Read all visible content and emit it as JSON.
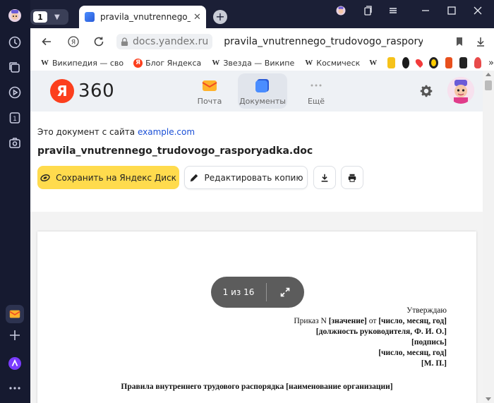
{
  "browser": {
    "tab_count": "1",
    "tab_title": "pravila_vnutrennego_tru",
    "address_domain": "docs.yandex.ru",
    "address_path": "pravila_vnutrennego_trudovogo_raspory"
  },
  "bookmarks": [
    {
      "icon": "W",
      "label": "Википедия — сво"
    },
    {
      "icon": "Я",
      "label": "Блог Яндекса"
    },
    {
      "icon": "W",
      "label": "Звезда — Википе"
    },
    {
      "icon": "W",
      "label": "Космическ"
    }
  ],
  "header": {
    "logo_letter": "Я",
    "logo_text": "360",
    "services": [
      {
        "label": "Почта"
      },
      {
        "label": "Документы"
      },
      {
        "label": "Ещё"
      }
    ]
  },
  "document": {
    "origin_prefix": "Это документ с сайта",
    "origin_link": "example.com",
    "filename": "pravila_vnutrennego_trudovogo_rasporyadka.doc"
  },
  "actions": {
    "save_label": "Сохранить на Яндекс Диск",
    "edit_label": "Редактировать копию"
  },
  "sheet": {
    "approve": "Утверждаю",
    "order_prefix": "Приказ N",
    "order_value": "[значение]",
    "order_mid": "от",
    "order_date": "[число, месяц, год]",
    "position": "[должность руководителя, Ф. И. О.]",
    "signature": "[подпись]",
    "date": "[число, месяц, год]",
    "stamp": "[М. П.]",
    "heading": "Правила внутреннего трудового распорядка [наименование организации]"
  },
  "pager": {
    "label": "1 из 16"
  },
  "colors": {
    "accent_yellow": "#ffdb4d",
    "yandex_red": "#fc3f1d",
    "link_blue": "#1a4fd6"
  }
}
